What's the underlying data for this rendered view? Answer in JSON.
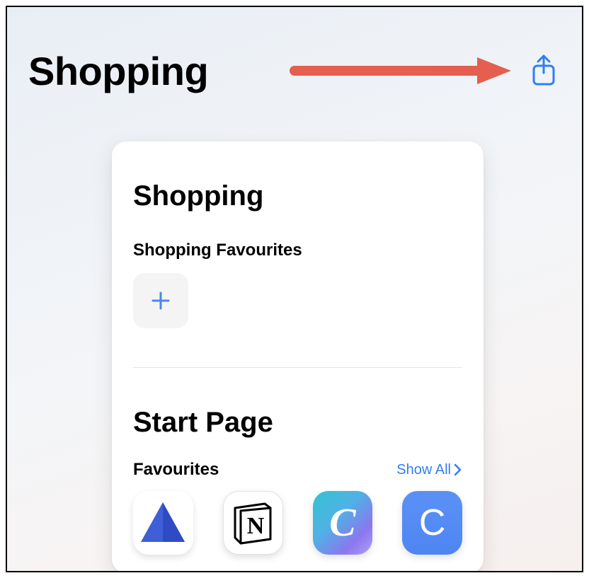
{
  "header": {
    "title": "Shopping"
  },
  "card": {
    "title": "Shopping",
    "favourites_label": "Shopping Favourites",
    "start_page_label": "Start Page",
    "favourites_header": "Favourites",
    "show_all_label": "Show All",
    "apps": [
      {
        "name": "favourite-app-1"
      },
      {
        "name": "favourite-app-2"
      },
      {
        "name": "favourite-app-3"
      },
      {
        "name": "favourite-app-4"
      }
    ]
  },
  "colors": {
    "accent": "#2f7ff2",
    "arrow": "#e45f4f"
  }
}
